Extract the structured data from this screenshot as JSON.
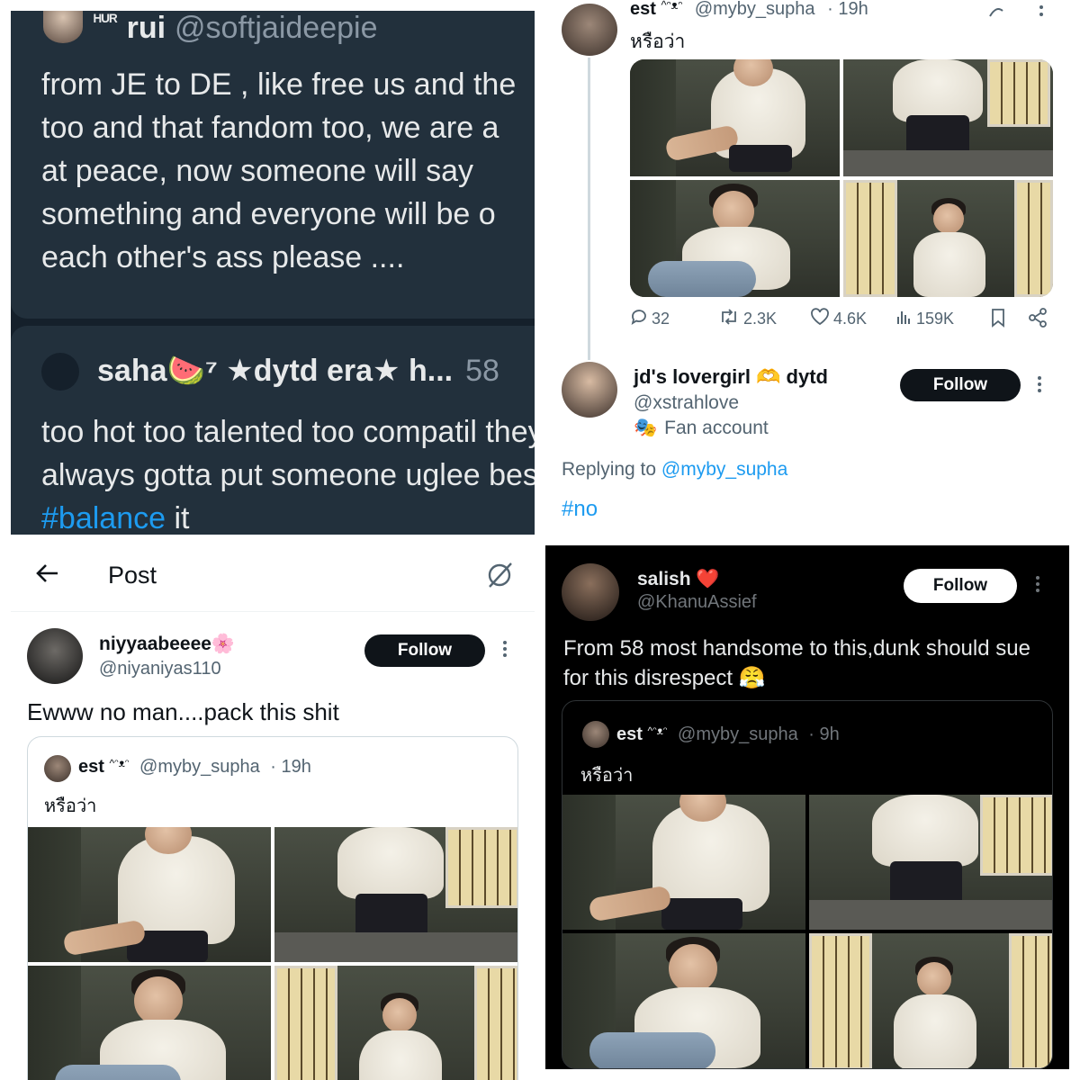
{
  "top_left": {
    "post1": {
      "name_prefix": "ᴴᵁᴿ",
      "name": "rui",
      "handle": "@softjaideepie",
      "text": "from JE to DE , like free us and the\ntoo and that fandom too, we are a\nat peace, now someone will say\nsomething and everyone will be o\neach other's ass please ...."
    },
    "post2": {
      "name": "saha🍉⁷ ★dytd era★ h...",
      "time": "58",
      "text_before": "too hot too talented too compatil they always gotta put someone uglee beside to ",
      "hashtag": "#balance",
      "text_after": " it"
    }
  },
  "top_right": {
    "quoted": {
      "name": "est",
      "badge": "^ᵔᴥᵔ",
      "handle": "@myby_supha",
      "time": "· 19h",
      "text": "หรือว่า"
    },
    "actions": {
      "replies": "32",
      "reposts": "2.3K",
      "likes": "4.6K",
      "views": "159K"
    },
    "reply": {
      "name": "jd's lovergirl 🫶 dytd",
      "handle": "@xstrahlove",
      "label_icon": "🎭",
      "label": "Fan account",
      "follow_label": "Follow",
      "replying_prefix": "Replying to ",
      "replying_to": "@myby_supha",
      "text": "#no"
    }
  },
  "bottom_left": {
    "topbar": {
      "title": "Post"
    },
    "author": {
      "name": "niyyaabeeee🌸",
      "handle": "@niyaniyas110",
      "follow_label": "Follow"
    },
    "text": "Ewww no man....pack this shit",
    "quote": {
      "name": "est",
      "badge": "^ᵔᴥᵔ",
      "handle": "@myby_supha",
      "time": "· 19h",
      "text": "หรือว่า"
    }
  },
  "bottom_right": {
    "author": {
      "name": "salish ❤️",
      "handle": "@KhanuAssief",
      "follow_label": "Follow"
    },
    "text": "From 58 most handsome to this,dunk should sue for this disrespect 😤",
    "quote": {
      "name": "est",
      "badge": "^ᵔᴥᵔ",
      "handle": "@myby_supha",
      "time": "· 9h",
      "text": "หรือว่า"
    }
  },
  "colors": {
    "link": "#1d9bf0",
    "dark_bg": "#15202b",
    "dark_card": "#22303c",
    "black_bg": "#000000"
  },
  "icons": [
    "reply-icon",
    "repost-icon",
    "like-icon",
    "views-icon",
    "bookmark-icon",
    "share-icon",
    "back-arrow-icon",
    "grok-icon",
    "more-icon"
  ]
}
